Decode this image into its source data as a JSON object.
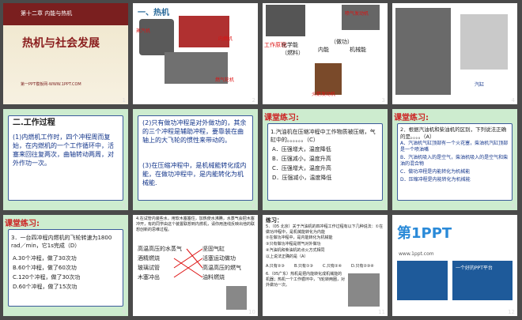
{
  "slides": [
    {
      "num": "1",
      "chapter": "第十二章 内能与热机",
      "title": "热机与社会发展",
      "footer": "第一PPT模板网-WWW.1PPT.COM"
    },
    {
      "num": "2",
      "heading": "一、热机",
      "captions": [
        "蒸汽机",
        "内燃机",
        "喷气式发动机",
        "燃气轮机"
      ]
    },
    {
      "num": "3",
      "caption_tl": "工作原理",
      "c1": "化学能",
      "c1b": "（燃料）",
      "c2": "内能",
      "c3": "（做功）",
      "c4": "机械能",
      "sub": "喷气发动机",
      "sub2": "火箭发动机"
    },
    {
      "num": "4",
      "caption": "汽缸"
    },
    {
      "num": "5",
      "heading": "二.工作过程",
      "body": "(1)内燃机工作时，四个冲程周而复始，在内燃机的一个工作循环中，活塞来回往复两次，曲轴转动两周，对外作功一次。"
    },
    {
      "num": "6",
      "p1": "(2)只有做功冲程是对外做功的，其余的三个冲程是辅助冲程，要靠装在曲轴上的大飞轮的惯性来带动的。",
      "p2": "(3)在压缩冲程中，是机械能转化成内能，在做功冲程中，是内能转化为机械能."
    },
    {
      "num": "7",
      "tag": "课堂练习:",
      "q": "1.汽油机在压缩冲程中工作物质被压缩，气缸中的。。。。。。（C）",
      "opts": [
        "A．压强增大，温度降低",
        "B．压强减小，温度升高",
        "C．压强增大，温度升高",
        "D．压强减小，温度降低"
      ]
    },
    {
      "num": "8",
      "tag": "课堂练习:",
      "q": "2．根据汽油机和柴油机的区别，下列说法正确的是。。。。（A）",
      "opts": [
        "A．汽油机气缸顶部有一个火花塞，柴油机汽缸顶部是一个喷油嘴",
        "B．汽油机吸入的是空气，柴油机吸入的是空气和柴油的混合物",
        "C．做功冲程是内能转化为机械能",
        "D．压缩冲程是内能转化为机械能"
      ]
    },
    {
      "num": "9",
      "tag": "课堂练习:",
      "q": "3．一台四冲程内燃机的飞轮转速为1800 rad／min，它1s完成（D）",
      "opts": [
        "A.30个冲程，做了30次功",
        "B.60个冲程，做了60次功",
        "C.120个冲程，做了30次功",
        "D.60个冲程，做了15次功"
      ]
    },
    {
      "num": "10",
      "intro": "4.在试管内装些水，用软木塞塞住，加热使水沸腾，水蒸气会把木塞冲开，有的同学由这个装置联想到内燃机，请你用连线反映出他的联想创新的思维过程。",
      "left": [
        "高温高压的水蒸气",
        "酒精燃烧",
        "玻璃试管",
        "木塞冲出"
      ],
      "right": [
        "坚固气缸",
        "活塞运动做功",
        "高温高压的燃气",
        "油料燃烧"
      ]
    },
    {
      "num": "11",
      "title": "练习：",
      "lines": [
        "5．（05 北京）关于汽油机的四冲程工作过程有以下几种说法：①在做功冲程中，是机械能转化为内能",
        "②在做功冲程中，是内能转化为机械能",
        "③只有做功冲程是燃气对外做功",
        "④汽油机和柴油机的点火方式相同",
        "以上说法正确的是（A）",
        "6.（05广东）热机是把内能转化成机械能的机器；热机一个工作循环中，飞轮转两圈，对外做功一次。"
      ],
      "choices": [
        "A.只有②③",
        "B.只有①③",
        "C.只有②④",
        "D.只有②③④"
      ]
    },
    {
      "num": "12",
      "logo": "第1PPT",
      "sub": "www.1ppt.com",
      "note": "一个好的PPT平台"
    }
  ]
}
